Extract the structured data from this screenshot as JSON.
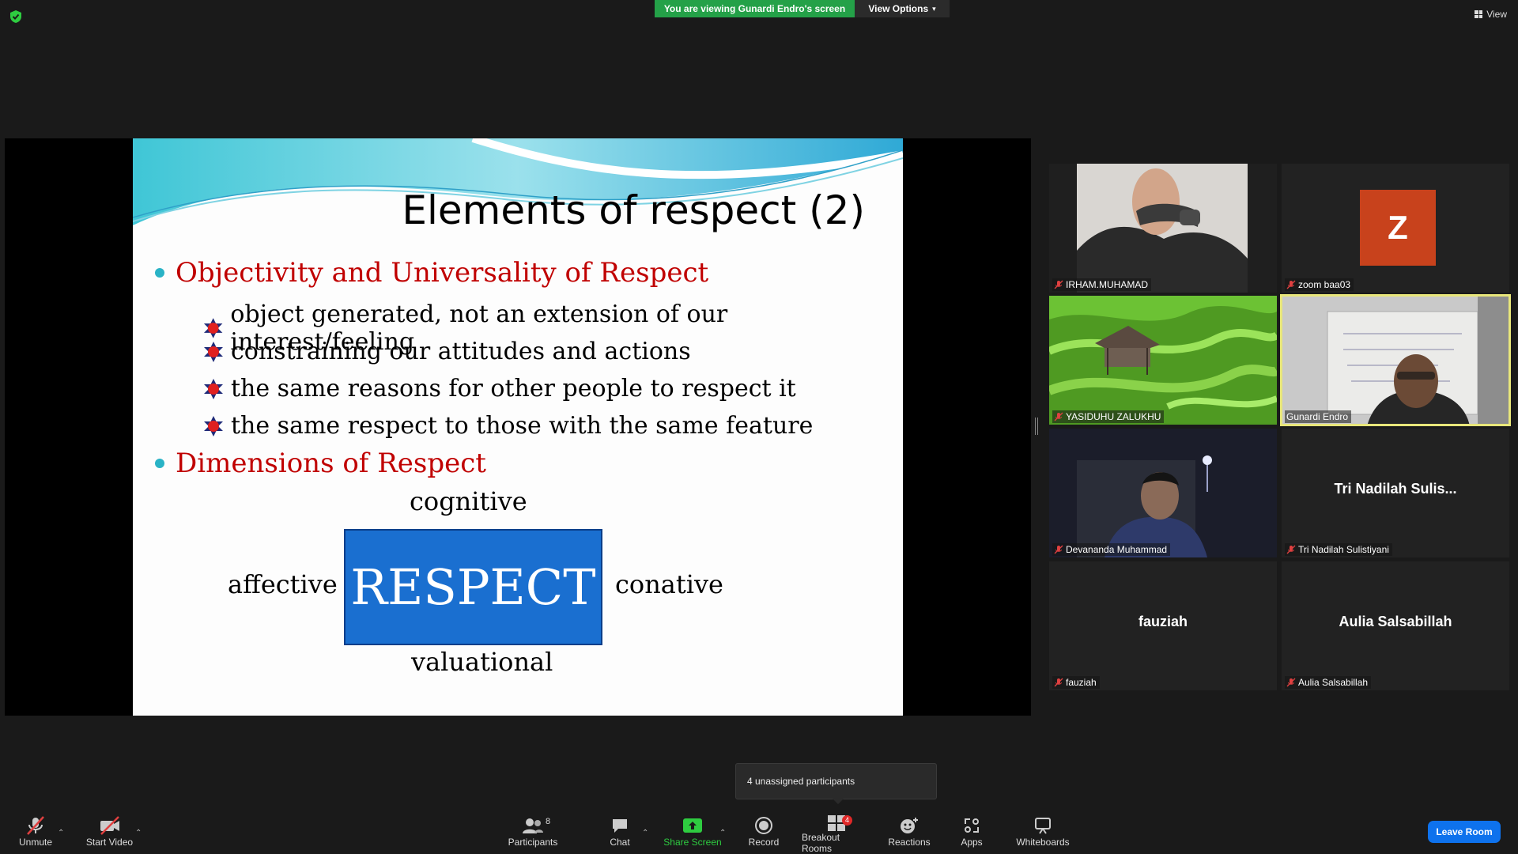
{
  "top": {
    "viewing_banner": "You are viewing Gunardi Endro's screen",
    "view_options": "View Options",
    "view_button": "View"
  },
  "slide": {
    "title": "Elements of respect (2)",
    "bullet1": "Objectivity  and Universality of Respect",
    "sub_bullets": [
      "object generated, not an extension of our interest/feeling",
      "constraining our attitudes and actions",
      "the same reasons for other people to respect it",
      "the same respect to those with the same feature"
    ],
    "bullet2": "Dimensions of Respect",
    "dimensions": {
      "top": "cognitive",
      "left": "affective",
      "right": "conative",
      "bottom": "valuational"
    },
    "center_box": "RESPECT"
  },
  "participants": [
    {
      "name": "IRHAM.MUHAMAD",
      "muted": true,
      "video": "webcam"
    },
    {
      "name": "zoom baa03",
      "muted": true,
      "avatar_letter": "Z",
      "avatar_color": "#c8421c"
    },
    {
      "name": "YASIDUHU ZALUKHU",
      "muted": true,
      "video": "rice-terrace-photo"
    },
    {
      "name": "Gunardi Endro",
      "muted": false,
      "video": "webcam",
      "active_speaker": true
    },
    {
      "name": "Devananda Muhammad",
      "muted": true,
      "video": "webcam"
    },
    {
      "name": "Tri Nadilah Sulistiyani",
      "muted": true,
      "center_label": "Tri  Nadilah  Sulis..."
    },
    {
      "name": "fauziah",
      "muted": true,
      "center_label": "fauziah"
    },
    {
      "name": "Aulia Salsabillah",
      "muted": true,
      "center_label": "Aulia Salsabillah"
    }
  ],
  "tooltip": "4 unassigned participants",
  "toolbar": {
    "unmute": "Unmute",
    "start_video": "Start Video",
    "participants": "Participants",
    "participants_count": "8",
    "chat": "Chat",
    "share_screen": "Share Screen",
    "record": "Record",
    "breakout_rooms": "Breakout Rooms",
    "breakout_badge": "4",
    "reactions": "Reactions",
    "apps": "Apps",
    "whiteboards": "Whiteboards",
    "leave": "Leave Room"
  },
  "colors": {
    "banner_green": "#24a148",
    "leave_blue": "#0e72ed",
    "slide_red": "#c00000",
    "respect_blue": "#1a6fd0",
    "active_speaker": "#e8e67a"
  }
}
